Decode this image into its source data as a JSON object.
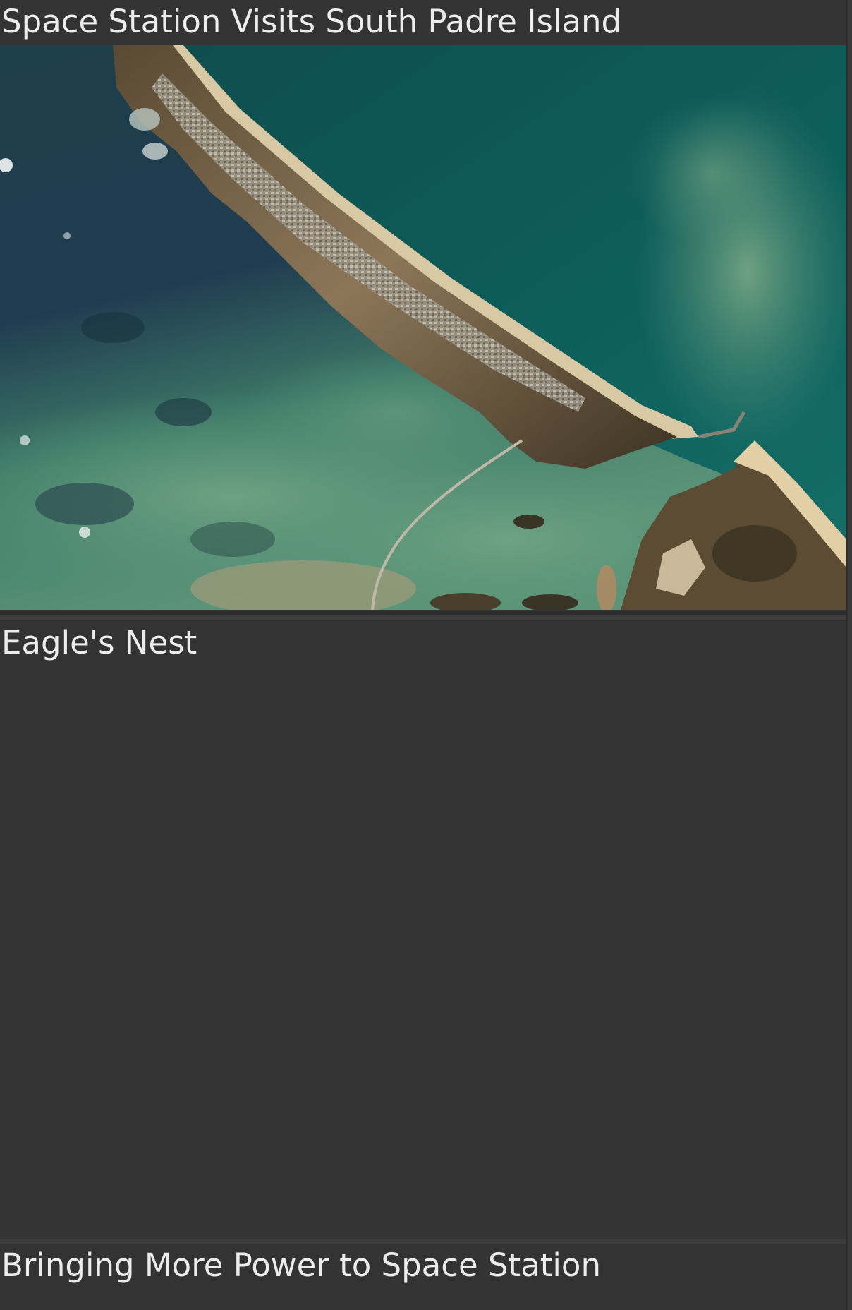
{
  "feed": {
    "items": [
      {
        "title": "Space Station Visits South Padre Island",
        "image_alt": "Aerial view of South Padre Island"
      },
      {
        "title": "Eagle's Nest"
      },
      {
        "title": "Bringing More Power to Space Station"
      }
    ]
  }
}
